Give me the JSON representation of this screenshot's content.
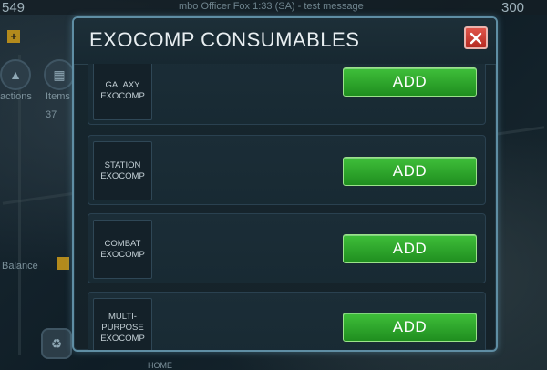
{
  "background": {
    "left_number": "549",
    "right_number": "300",
    "message": "mbo Officer Fox 1:33 (SA) - test message",
    "left_labels": [
      "actions",
      "Items"
    ],
    "items_count": "37",
    "balance_label": "Balance",
    "home_label": "HOME"
  },
  "modal": {
    "title": "EXOCOMP CONSUMABLES",
    "close_icon": "x-icon",
    "accent_color": "#5f8ea4",
    "add_button_color": "#2da62b",
    "items": [
      {
        "label": "GALAXY\nEXOCOMP",
        "button": "ADD"
      },
      {
        "label": "STATION\nEXOCOMP",
        "button": "ADD"
      },
      {
        "label": "COMBAT\nEXOCOMP",
        "button": "ADD"
      },
      {
        "label": "MULTI-\nPURPOSE\nEXOCOMP",
        "button": "ADD"
      }
    ]
  }
}
